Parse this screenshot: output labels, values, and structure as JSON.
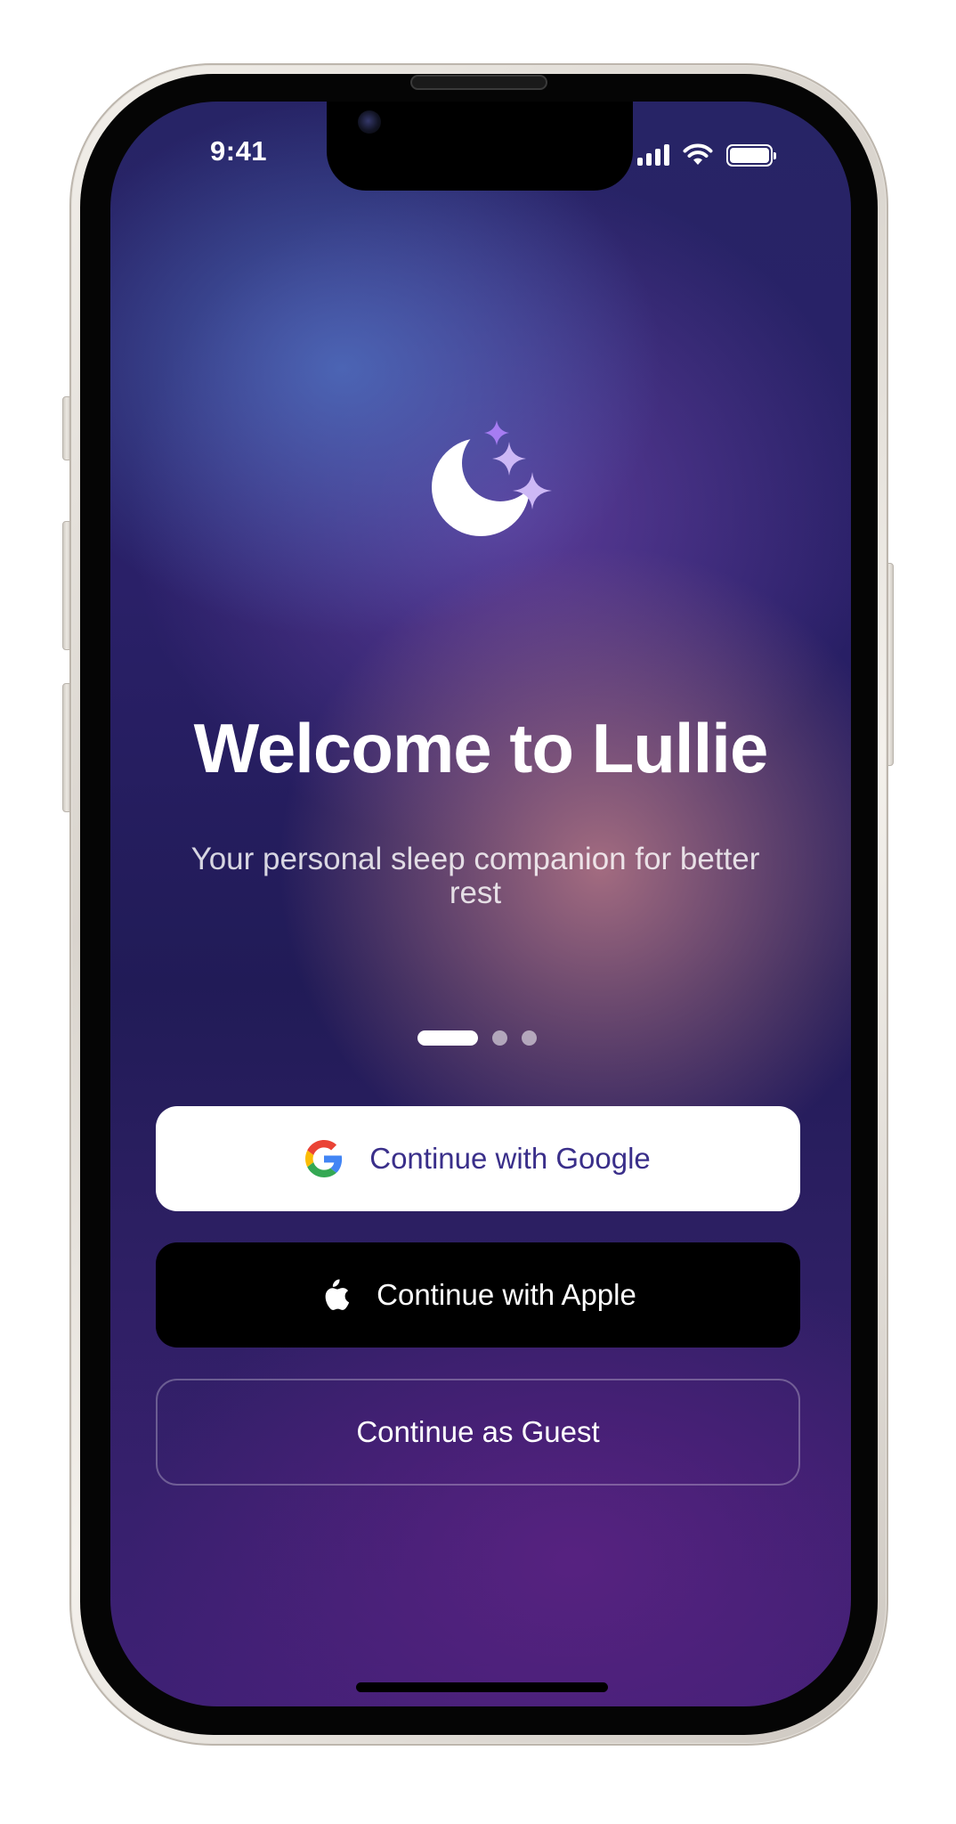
{
  "status_bar": {
    "time": "9:41",
    "icons": [
      "cellular-signal-icon",
      "wifi-icon",
      "battery-icon"
    ]
  },
  "app": {
    "name": "Lullie",
    "logo_icon": "moon-stars-icon"
  },
  "onboarding": {
    "title": "Welcome to Lullie",
    "subtitle": "Your personal sleep companion for better rest",
    "pager": {
      "total_pages": 3,
      "active_page": 1
    }
  },
  "auth": {
    "google_label": "Continue with Google",
    "google_icon": "google-logo-icon",
    "apple_label": "Continue with Apple",
    "apple_icon": "apple-logo-icon",
    "guest_label": "Continue as Guest"
  },
  "colors": {
    "background_top": "#272466",
    "background_bottom": "#3f2075",
    "accent_purple": "#a67cf2",
    "google_text": "#3a2f8a",
    "apple_button": "#000000"
  }
}
